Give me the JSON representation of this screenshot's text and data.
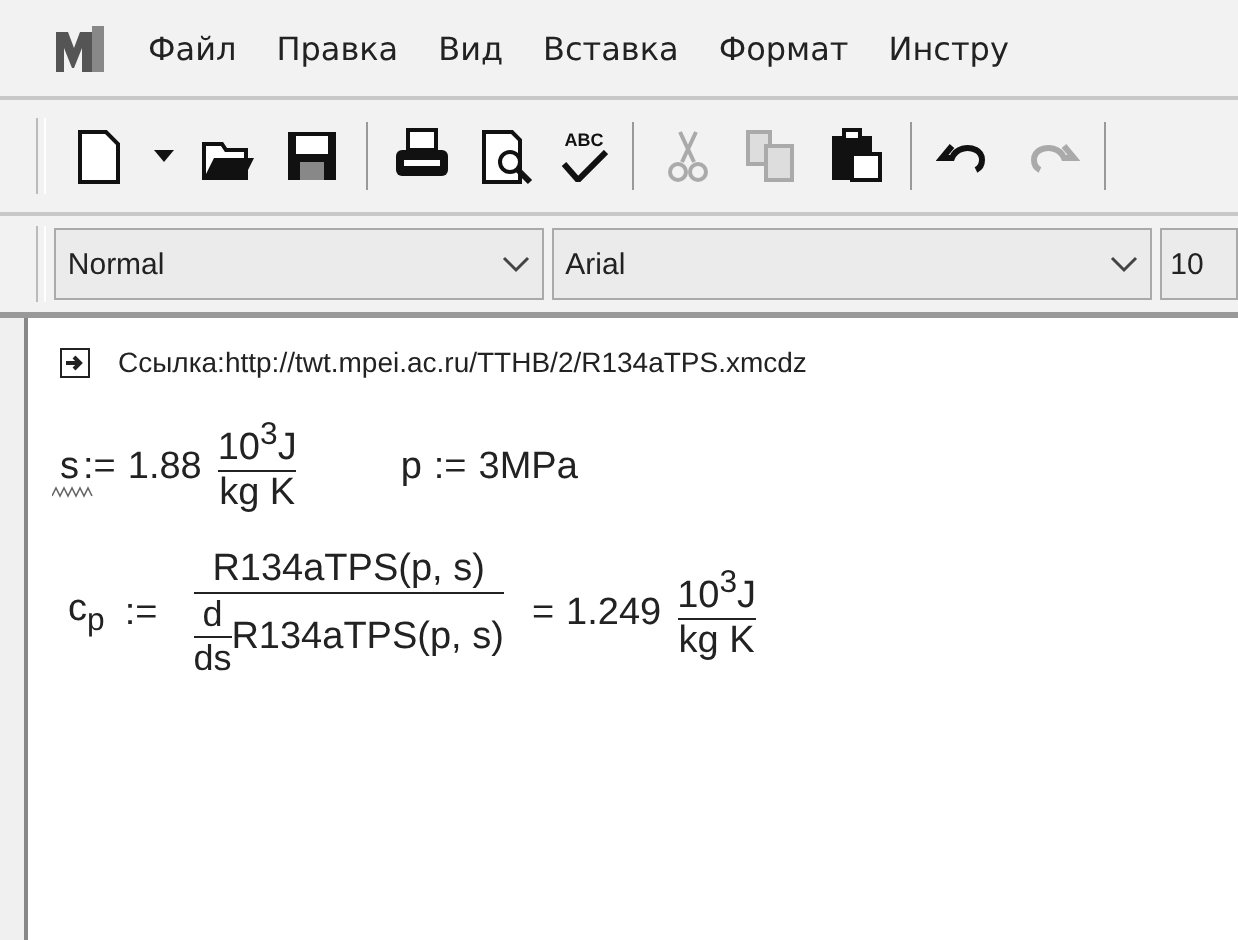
{
  "menu": [
    "Файл",
    "Правка",
    "Вид",
    "Вставка",
    "Формат",
    "Инстру"
  ],
  "toolbar": [
    {
      "kind": "new",
      "disabled": false
    },
    {
      "kind": "dropdown",
      "disabled": false
    },
    {
      "kind": "open",
      "disabled": false
    },
    {
      "kind": "save",
      "disabled": false
    },
    {
      "kind": "sep"
    },
    {
      "kind": "print",
      "disabled": false
    },
    {
      "kind": "preview",
      "disabled": false
    },
    {
      "kind": "spell",
      "label": "ABC",
      "disabled": false
    },
    {
      "kind": "sep"
    },
    {
      "kind": "cut",
      "disabled": true
    },
    {
      "kind": "copy",
      "disabled": true
    },
    {
      "kind": "paste",
      "disabled": false
    },
    {
      "kind": "sep"
    },
    {
      "kind": "undo",
      "disabled": false
    },
    {
      "kind": "redo",
      "disabled": true
    },
    {
      "kind": "sep"
    }
  ],
  "format_bar": {
    "style": "Normal",
    "font": "Arial",
    "size": "10"
  },
  "worksheet": {
    "link": "Ссылка:http://twt.mpei.ac.ru/TTHB/2/R134aTPS.xmcdz",
    "s_def": {
      "name": "s",
      "op": ":=",
      "value": "1.88",
      "unit_num": "10$^{3}$J",
      "unit_den": "kg K",
      "warning": true
    },
    "p_def": {
      "name": "p",
      "op": ":=",
      "value": "3MPa"
    },
    "cp_def": {
      "name": "c$_{p}$",
      "op": ":=",
      "numerator": "R134aTPS(p, s)",
      "deriv_num": "d",
      "deriv_den": "ds",
      "denominator": "R134aTPS(p, s)",
      "eq": "=",
      "value": "1.249",
      "unit_num": "10$^{3}$J",
      "unit_den": "kg K"
    }
  }
}
